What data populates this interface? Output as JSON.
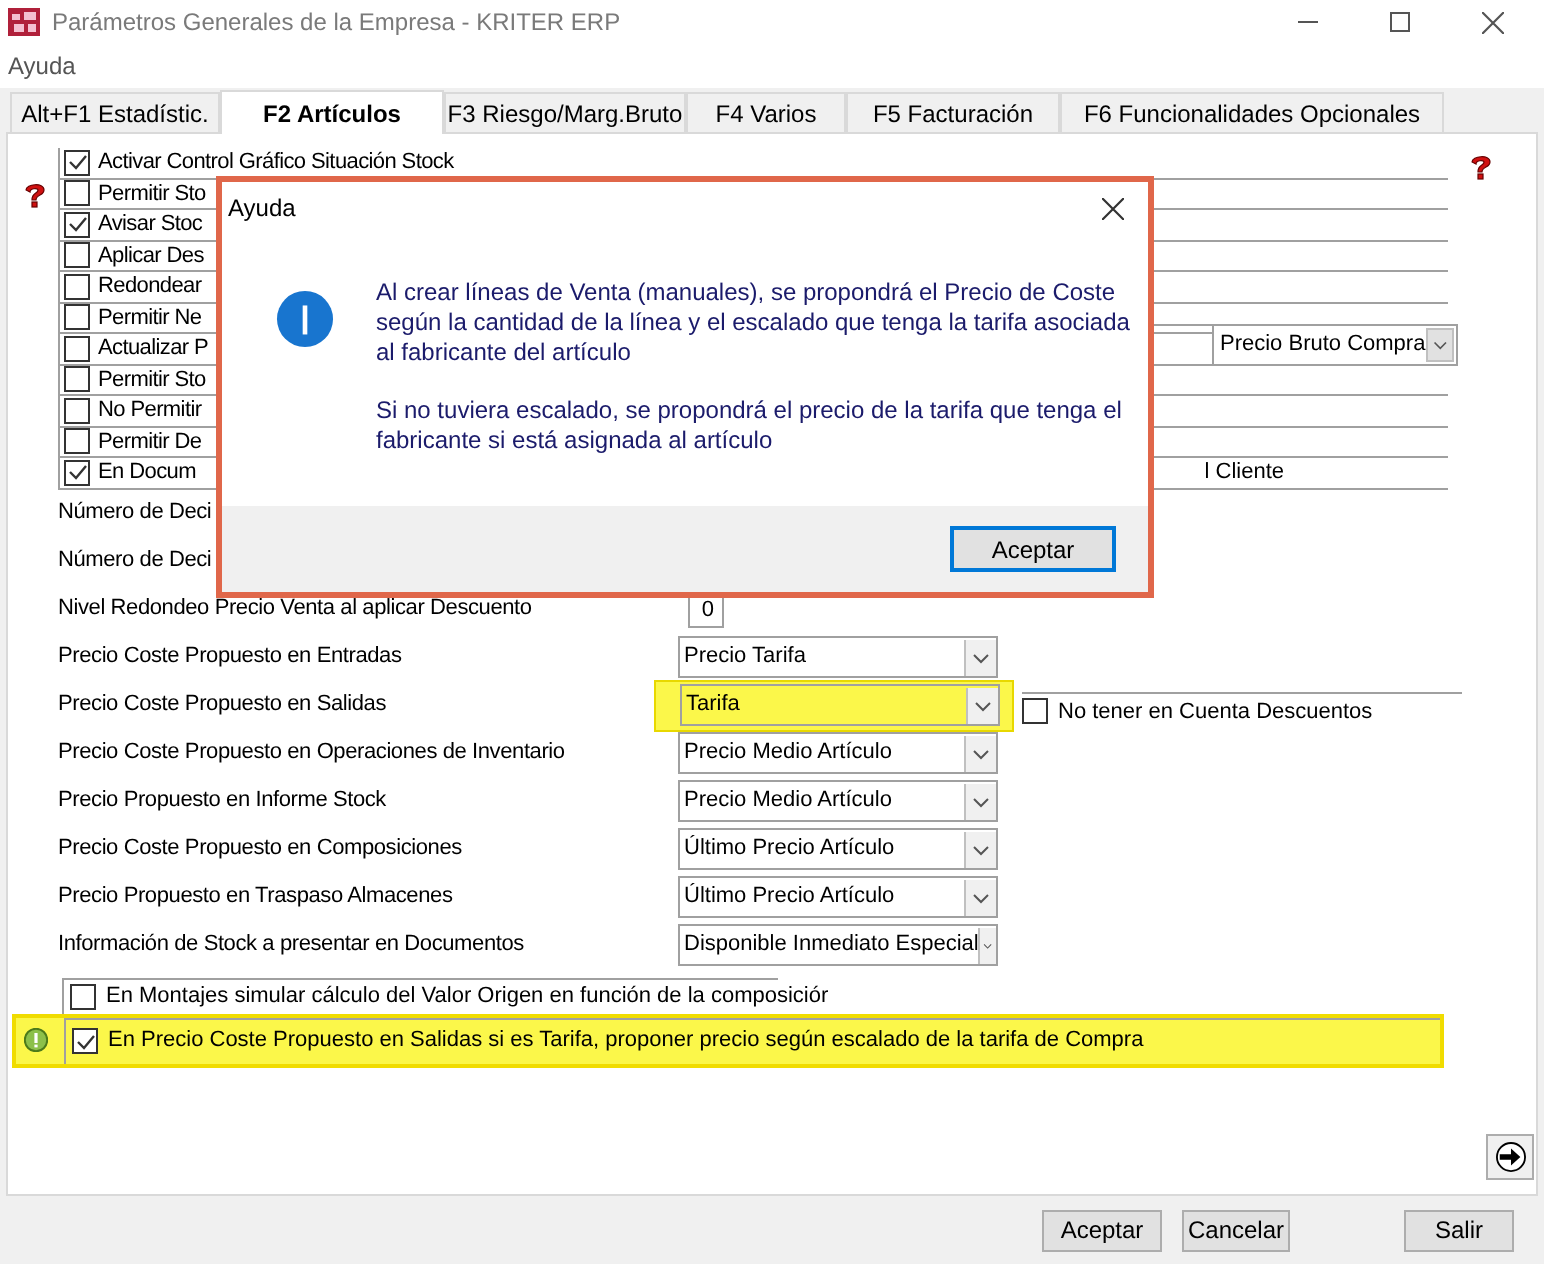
{
  "window": {
    "title": "Parámetros Generales de la Empresa - KRITER ERP"
  },
  "menu_bar": [
    {
      "label": "Ayuda"
    }
  ],
  "tabs": [
    {
      "label": "Alt+F1 Estadístic.",
      "selected": false
    },
    {
      "label": "F2 Artículos",
      "selected": true
    },
    {
      "label": "F3 Riesgo/Marg.Bruto",
      "selected": false
    },
    {
      "label": "F4 Varios",
      "selected": false
    },
    {
      "label": "F5 Facturación",
      "selected": false
    },
    {
      "label": "F6 Funcionalidades Opcionales",
      "selected": false
    }
  ],
  "checklist": [
    {
      "label": "Activar Control Gráfico Situación Stock",
      "checked": true
    },
    {
      "label": "Permitir Sto",
      "checked": false
    },
    {
      "label": "Avisar Stoc",
      "checked": true
    },
    {
      "label": "Aplicar Des",
      "checked": false
    },
    {
      "label": "Redondear",
      "checked": false
    },
    {
      "label": "Permitir Ne",
      "checked": false
    },
    {
      "label": "Actualizar P",
      "checked": false
    },
    {
      "label": "Permitir Sto",
      "checked": false
    },
    {
      "label": "No Permitir",
      "checked": false
    },
    {
      "label": "Permitir De",
      "checked": false
    },
    {
      "label": "En Docum",
      "checked": true,
      "tail": "l Cliente"
    }
  ],
  "side_select": {
    "value": "Precio Bruto Compra"
  },
  "fields": [
    {
      "kind": "label",
      "label": "Número de Deci"
    },
    {
      "kind": "label",
      "label": "Número de Deci"
    },
    {
      "kind": "number",
      "label": "Nivel Redondeo Precio Venta al aplicar Descuento",
      "value": "0"
    },
    {
      "kind": "select",
      "label": "Precio Coste Propuesto en Entradas",
      "value": "Precio Tarifa",
      "highlighted": false
    },
    {
      "kind": "select",
      "label": "Precio Coste Propuesto en Salidas",
      "value": "Tarifa",
      "highlighted": true,
      "side_checkbox": {
        "label": "No tener en Cuenta Descuentos",
        "checked": false
      }
    },
    {
      "kind": "select",
      "label": "Precio Coste Propuesto en Operaciones de Inventario",
      "value": "Precio Medio Artículo",
      "highlighted": false
    },
    {
      "kind": "select",
      "label": "Precio Propuesto en Informe Stock",
      "value": "Precio Medio Artículo",
      "highlighted": false
    },
    {
      "kind": "select",
      "label": "Precio Coste Propuesto en Composiciones",
      "value": "Último Precio Artículo",
      "highlighted": false
    },
    {
      "kind": "select",
      "label": "Precio Propuesto en Traspaso Almacenes",
      "value": "Último Precio Artículo",
      "highlighted": false
    },
    {
      "kind": "select",
      "label": "Información de Stock a presentar en Documentos",
      "value": "Disponible Inmediato Especial",
      "highlighted": false
    }
  ],
  "options": [
    {
      "label": "En Montajes simular cálculo del Valor Origen en función de la composiciór",
      "checked": false,
      "highlighted": false,
      "info": false
    },
    {
      "label": "En Precio Coste Propuesto en Salidas si es Tarifa, proponer precio según escalado de la tarifa de Compra",
      "checked": true,
      "highlighted": true,
      "info": true
    }
  ],
  "buttons": [
    {
      "label": "Aceptar"
    },
    {
      "label": "Cancelar"
    },
    {
      "label": "Salir"
    }
  ],
  "dialog": {
    "title": "Ayuda",
    "paragraphs": [
      "Al crear líneas de Venta (manuales), se propondrá el Precio de Coste según la cantidad de la línea y el escalado que tenga la tarifa asociada al fabricante del artículo",
      "Si no tuviera escalado, se propondrá el precio de la tarifa que tenga el fabricante si está asignada al artículo"
    ],
    "button": "Aceptar"
  }
}
